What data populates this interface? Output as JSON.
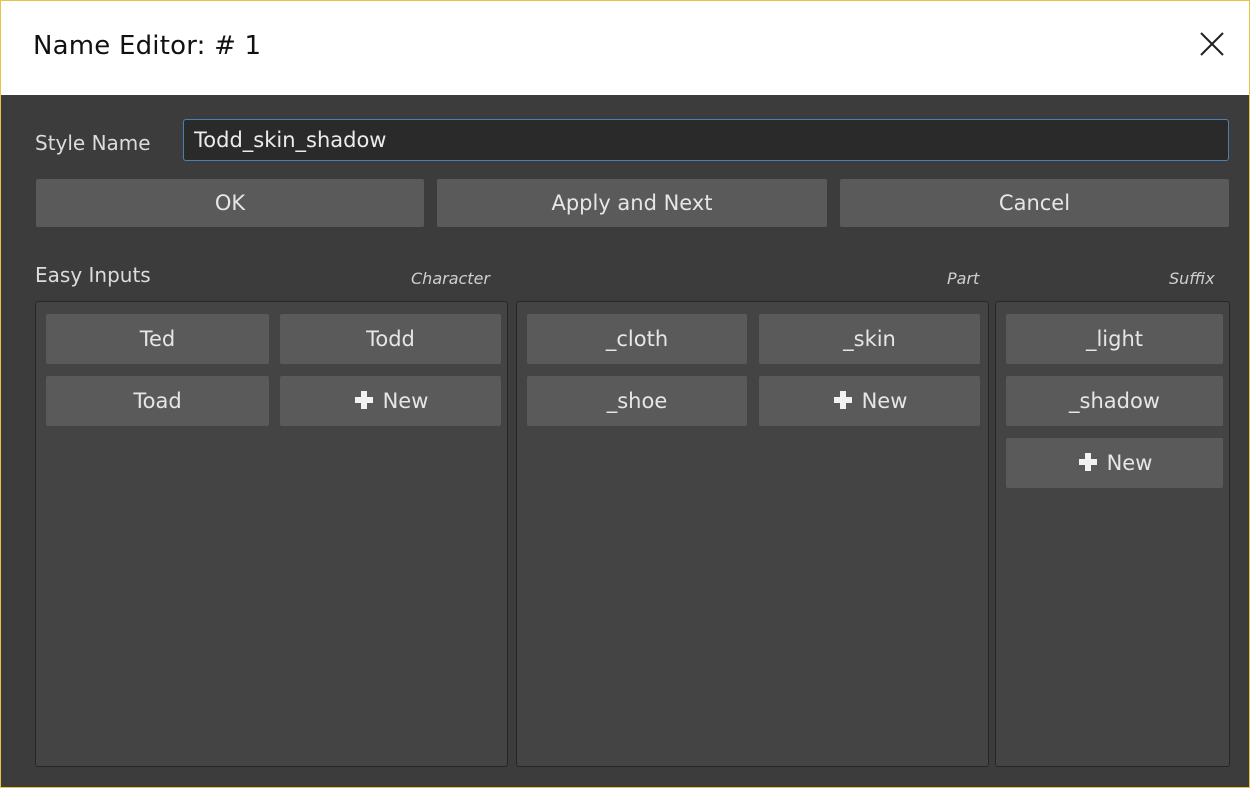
{
  "window": {
    "title": "Name Editor: # 1"
  },
  "icons": {
    "close": "close-icon",
    "plus": "plus-icon"
  },
  "style_name": {
    "label": "Style Name",
    "value": "Todd_skin_shadow"
  },
  "actions": {
    "ok_label": "OK",
    "apply_next_label": "Apply and Next",
    "cancel_label": "Cancel"
  },
  "easy_inputs": {
    "label": "Easy Inputs",
    "character": {
      "label": "Character",
      "items": [
        "Ted",
        "Todd",
        "Toad"
      ],
      "new_label": "New"
    },
    "part": {
      "label": "Part",
      "items": [
        "_cloth",
        "_skin",
        "_shoe"
      ],
      "new_label": "New"
    },
    "suffix": {
      "label": "Suffix",
      "items": [
        "_light",
        "_shadow"
      ],
      "new_label": "New"
    }
  },
  "colors": {
    "background": "#3c3c3c",
    "button": "#5a5a5a",
    "input_border": "#4a7fb4",
    "window_border": "#e8c34a"
  }
}
